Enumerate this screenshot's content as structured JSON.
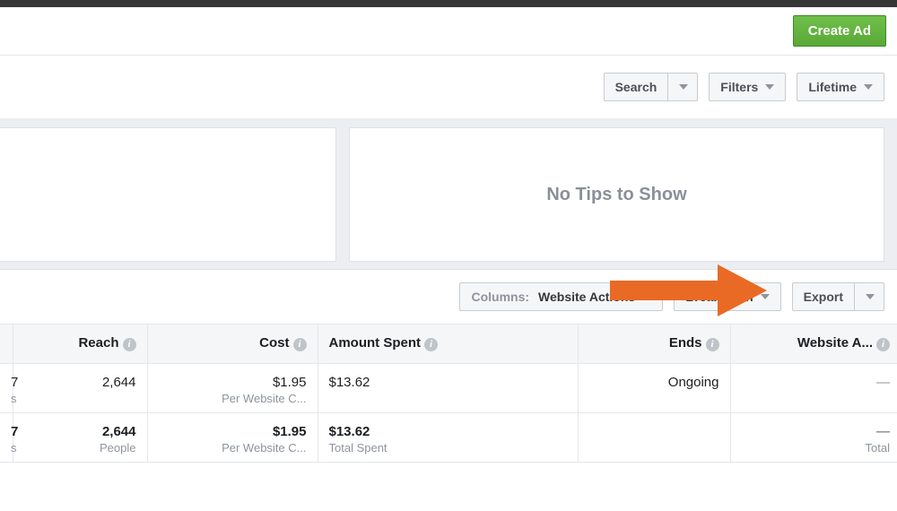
{
  "header": {
    "create_ad": "Create Ad"
  },
  "tools": {
    "search": "Search",
    "filters": "Filters",
    "date_range": "Lifetime"
  },
  "tips": {
    "empty": "No Tips to Show"
  },
  "table_toolbar": {
    "columns_label": "Columns:",
    "columns_value": "Website Actions",
    "breakdown": "Breakdown",
    "export": "Export"
  },
  "columns": {
    "reach": "Reach",
    "cost": "Cost",
    "amount_spent": "Amount Spent",
    "ends": "Ends",
    "website_actions": "Website A..."
  },
  "rows": [
    {
      "stub": "7",
      "stub_sub": "s",
      "reach": "2,644",
      "cost": "$1.95",
      "cost_sub": "Per Website C...",
      "amount_spent": "$13.62",
      "ends": "Ongoing",
      "website_actions": "—"
    }
  ],
  "totals": {
    "stub": "7",
    "stub_sub": "s",
    "reach": "2,644",
    "reach_sub": "People",
    "cost": "$1.95",
    "cost_sub": "Per Website C...",
    "amount_spent": "$13.62",
    "amount_spent_sub": "Total Spent",
    "website_actions": "—",
    "website_actions_sub": "Total"
  }
}
